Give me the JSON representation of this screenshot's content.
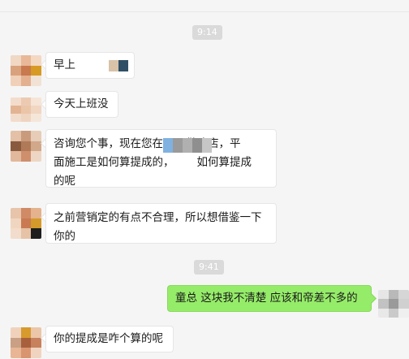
{
  "timestamps": [
    "9:14",
    "9:41"
  ],
  "messages": [
    {
      "side": "left",
      "text": "早上"
    },
    {
      "side": "left",
      "text": "今天上班没"
    },
    {
      "side": "left",
      "lines": [
        "咨询您个事，现在您在",
        "做建店，平",
        "面施工是如何算提成的，",
        "如何算提成",
        "的呢"
      ]
    },
    {
      "side": "left",
      "lines": [
        "之前营销定的有点不合理，所以想借鉴一下",
        "你的"
      ]
    },
    {
      "side": "right",
      "text": "童总 这块我不清楚 应该和帝差不多的"
    },
    {
      "side": "left",
      "text": "你的提成是咋个算的呢"
    }
  ],
  "colors": {
    "background": "#f5f5f5",
    "bubble_incoming": "#ffffff",
    "bubble_outgoing": "#95ec69",
    "time_badge": "#dadada"
  }
}
